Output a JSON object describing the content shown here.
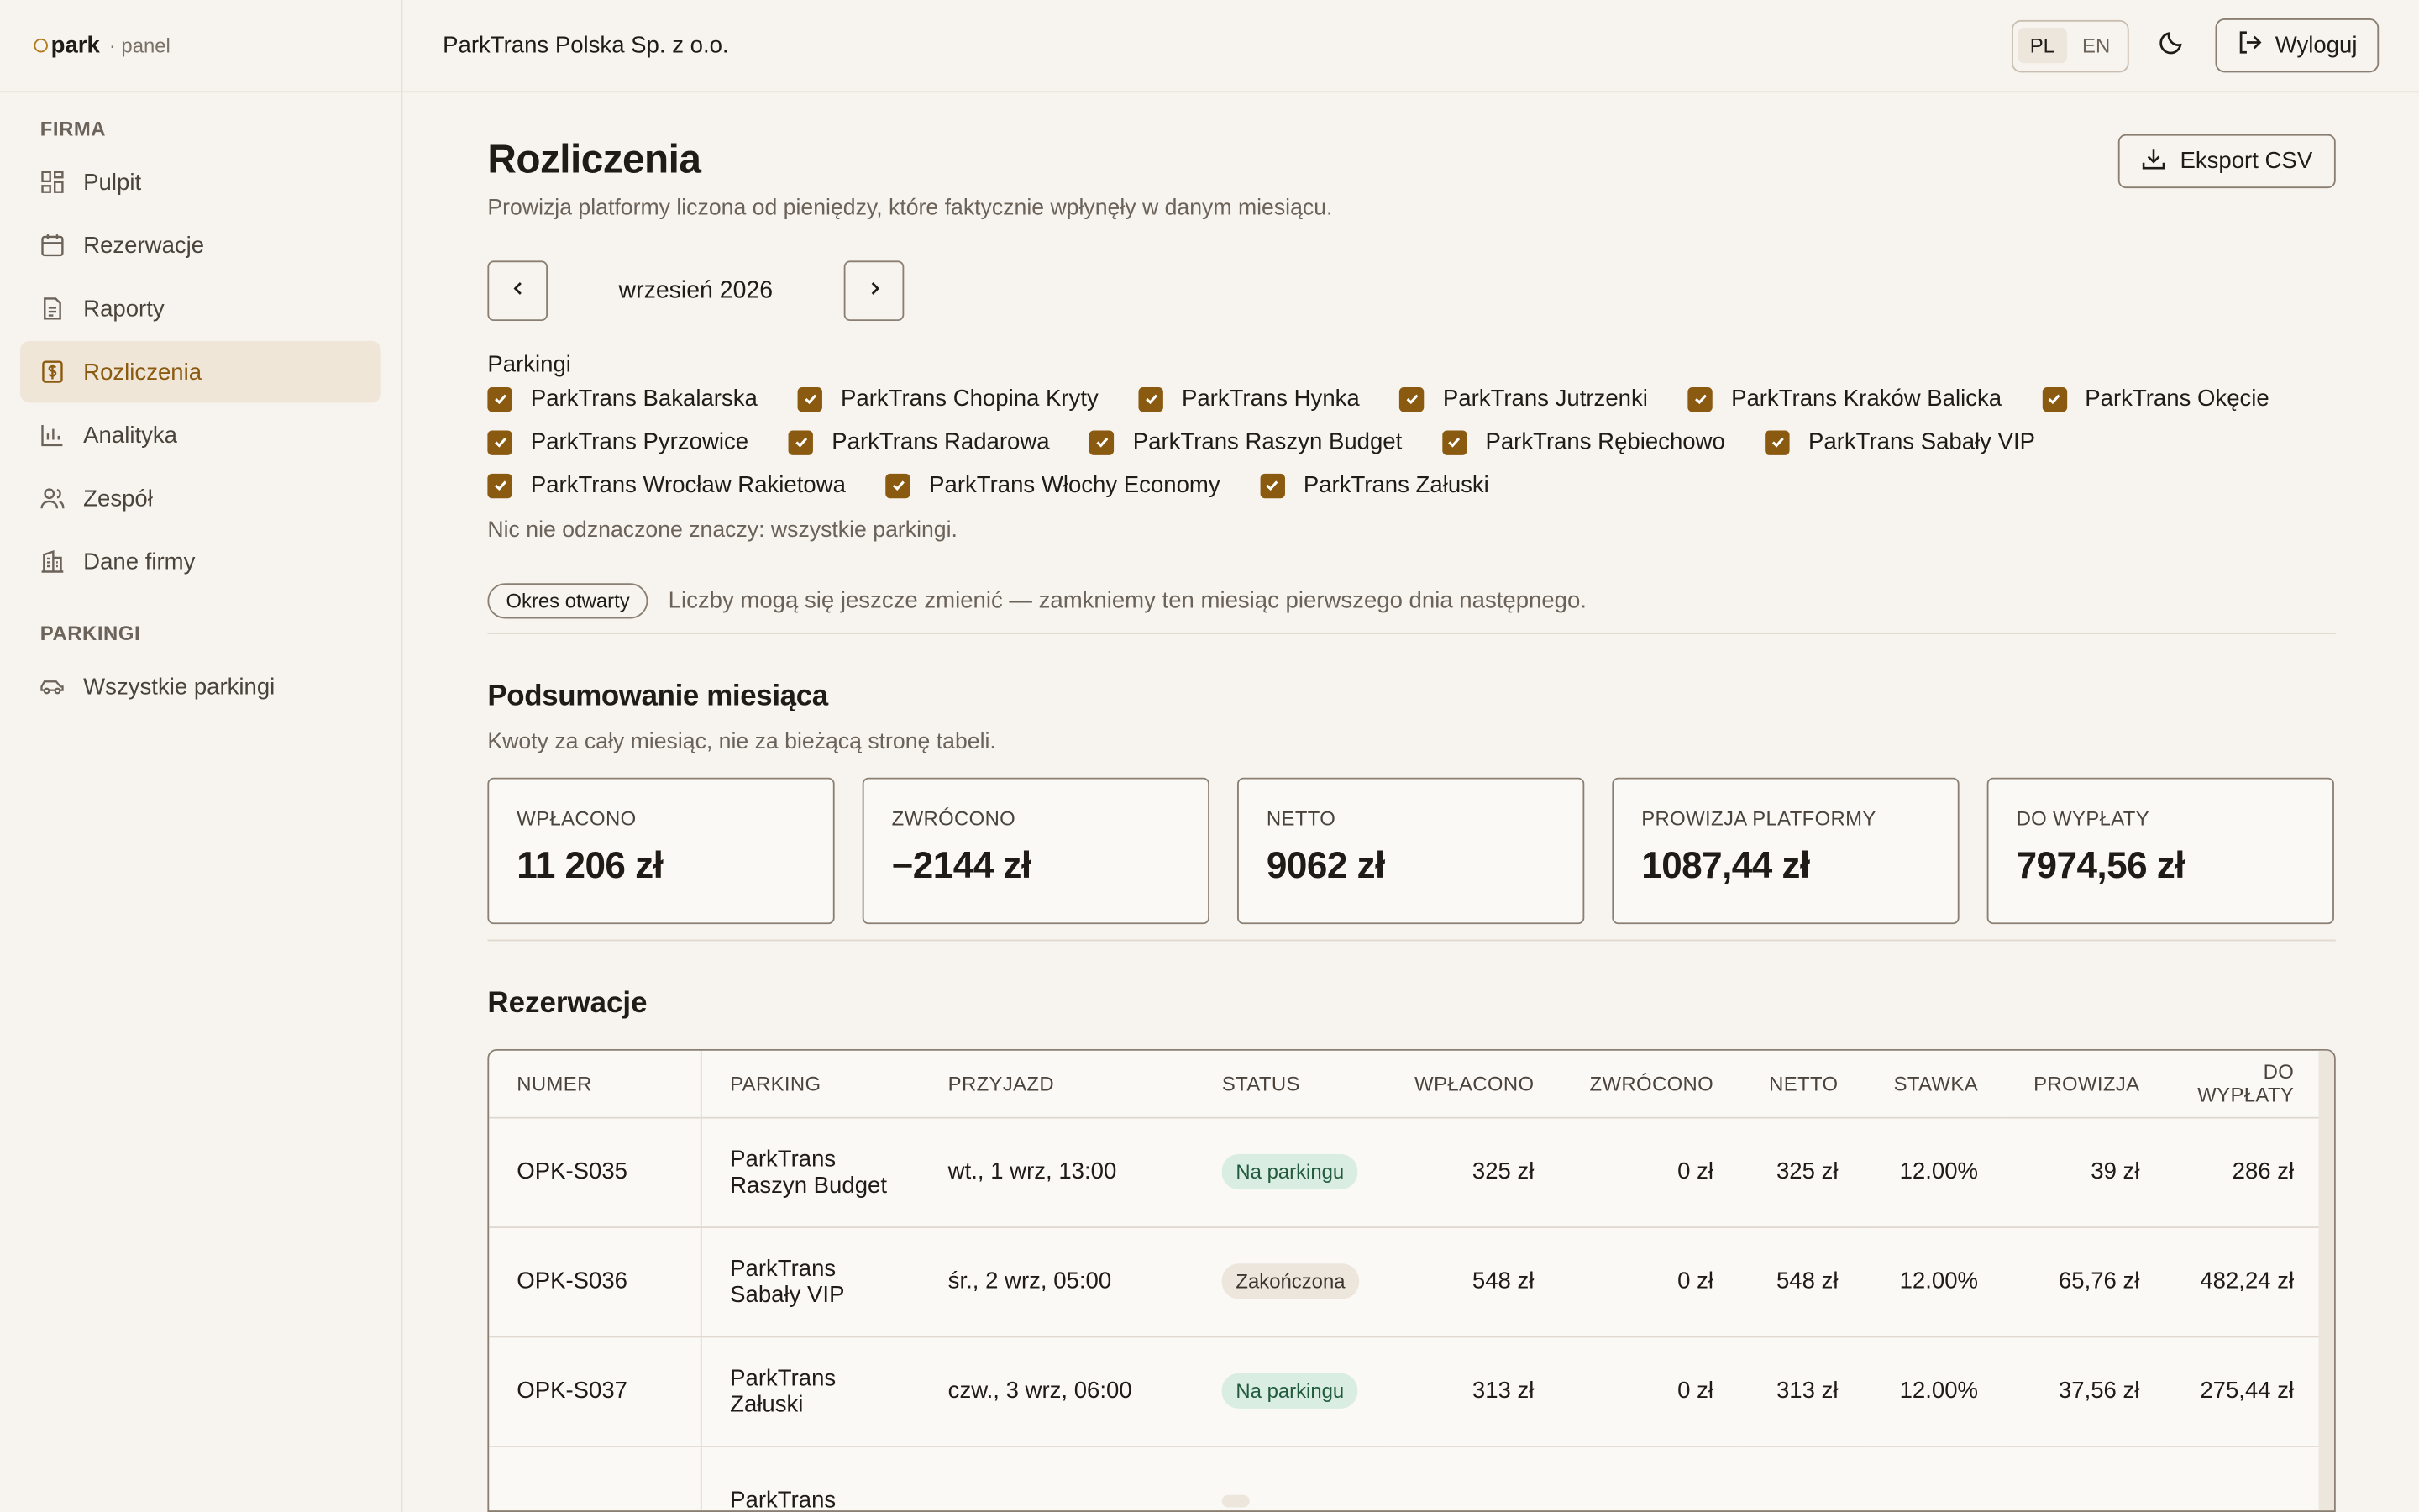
{
  "brand": {
    "name": "park",
    "sub": "· panel"
  },
  "sidebar": {
    "section1": "FIRMA",
    "items": [
      {
        "label": "Pulpit",
        "icon": "dashboard-icon"
      },
      {
        "label": "Rezerwacje",
        "icon": "calendar-icon"
      },
      {
        "label": "Raporty",
        "icon": "document-icon"
      },
      {
        "label": "Rozliczenia",
        "icon": "dollar-icon",
        "active": true
      },
      {
        "label": "Analityka",
        "icon": "bar-chart-icon"
      },
      {
        "label": "Zespół",
        "icon": "users-icon"
      },
      {
        "label": "Dane firmy",
        "icon": "building-icon"
      }
    ],
    "section2": "PARKINGI",
    "items2": [
      {
        "label": "Wszystkie parkingi",
        "icon": "car-icon"
      }
    ]
  },
  "topbar": {
    "company": "ParkTrans Polska Sp. z o.o.",
    "lang_pl": "PL",
    "lang_en": "EN",
    "logout": "Wyloguj"
  },
  "page": {
    "title": "Rozliczenia",
    "subtitle": "Prowizja platformy liczona od pieniędzy, które faktycznie wpłynęły w danym miesiącu.",
    "export": "Eksport CSV",
    "month": "wrzesień 2026",
    "parkings_title": "Parkingi",
    "parkings": [
      "ParkTrans Bakalarska",
      "ParkTrans Chopina Kryty",
      "ParkTrans Hynka",
      "ParkTrans Jutrzenki",
      "ParkTrans Kraków Balicka",
      "ParkTrans Okęcie",
      "ParkTrans Pyrzowice",
      "ParkTrans Radarowa",
      "ParkTrans Raszyn Budget",
      "ParkTrans Rębiechowo",
      "ParkTrans Sabały VIP",
      "ParkTrans Wrocław Rakietowa",
      "ParkTrans Włochy Economy",
      "ParkTrans Załuski"
    ],
    "parkings_hint": "Nic nie odznaczone znaczy: wszystkie parkingi.",
    "open_badge": "Okres otwarty",
    "open_text": "Liczby mogą się jeszcze zmienić — zamkniemy ten miesiąc pierwszego dnia następnego."
  },
  "summary": {
    "title": "Podsumowanie miesiąca",
    "subtitle": "Kwoty za cały miesiąc, nie za bieżącą stronę tabeli.",
    "cards": [
      {
        "label": "WPŁACONO",
        "value": "11 206 zł"
      },
      {
        "label": "ZWRÓCONO",
        "value": "−2144 zł"
      },
      {
        "label": "NETTO",
        "value": "9062 zł"
      },
      {
        "label": "PROWIZJA PLATFORMY",
        "value": "1087,44 zł"
      },
      {
        "label": "DO WYPŁATY",
        "value": "7974,56 zł"
      }
    ]
  },
  "reservations": {
    "title": "Rezerwacje",
    "headers": [
      "NUMER",
      "PARKING",
      "PRZYJAZD",
      "STATUS",
      "WPŁACONO",
      "ZWRÓCONO",
      "NETTO",
      "STAWKA",
      "PROWIZJA",
      "DO WYPŁATY"
    ],
    "rows": [
      {
        "num": "OPK-S035",
        "parking1": "ParkTrans",
        "parking2": "Raszyn Budget",
        "arrival": "wt., 1 wrz, 13:00",
        "status": "Na parkingu",
        "status_type": "green",
        "paid": "325 zł",
        "refund": "0 zł",
        "net": "325 zł",
        "rate": "12.00%",
        "fee": "39 zł",
        "payout": "286 zł"
      },
      {
        "num": "OPK-S036",
        "parking1": "ParkTrans",
        "parking2": "Sabały VIP",
        "arrival": "śr., 2 wrz, 05:00",
        "status": "Zakończona",
        "status_type": "grey",
        "paid": "548 zł",
        "refund": "0 zł",
        "net": "548 zł",
        "rate": "12.00%",
        "fee": "65,76 zł",
        "payout": "482,24 zł"
      },
      {
        "num": "OPK-S037",
        "parking1": "ParkTrans",
        "parking2": "Załuski",
        "arrival": "czw., 3 wrz, 06:00",
        "status": "Na parkingu",
        "status_type": "green",
        "paid": "313 zł",
        "refund": "0 zł",
        "net": "313 zł",
        "rate": "12.00%",
        "fee": "37,56 zł",
        "payout": "275,44 zł"
      },
      {
        "num": "",
        "parking1": "ParkTrans",
        "parking2": "",
        "arrival": "",
        "status": "",
        "status_type": "grey",
        "paid": "",
        "refund": "",
        "net": "",
        "rate": "",
        "fee": "",
        "payout": ""
      }
    ]
  }
}
